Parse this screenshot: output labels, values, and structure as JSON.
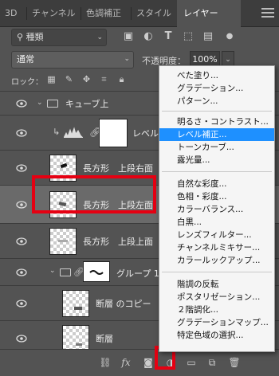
{
  "tabs": [
    "3D",
    "チャンネル",
    "色調補正",
    "スタイル",
    "レイヤー"
  ],
  "active_tab": "レイヤー",
  "toolbar": {
    "filter_label": "種類",
    "blend_mode": "通常",
    "opacity_label": "不透明度：",
    "opacity_value": "100%",
    "lock_label": "ロック："
  },
  "layers": [
    {
      "name": "キューブ上",
      "kind": "group"
    },
    {
      "name": "レベル補正",
      "kind": "adjustment"
    },
    {
      "name": "長方形　上段右面",
      "kind": "shape"
    },
    {
      "name": "長方形　上段左面",
      "kind": "shape",
      "selected": true
    },
    {
      "name": "長方形　上段上面",
      "kind": "shape"
    },
    {
      "name": "グループ 1",
      "kind": "group"
    },
    {
      "name": "断層 のコピー",
      "kind": "layer"
    },
    {
      "name": "断層",
      "kind": "layer"
    }
  ],
  "adjustment_menu": {
    "groups": [
      [
        "べた塗り...",
        "グラデーション...",
        "パターン..."
      ],
      [
        "明るさ・コントラスト...",
        "レベル補正...",
        "トーンカーブ...",
        "露光量..."
      ],
      [
        "自然な彩度...",
        "色相・彩度...",
        "カラーバランス...",
        "白黒...",
        "レンズフィルター...",
        "チャンネルミキサー...",
        "カラールックアップ..."
      ],
      [
        "階調の反転",
        "ポスタリゼーション...",
        "２階調化...",
        "グラデーションマップ...",
        "特定色域の選択..."
      ]
    ],
    "highlighted": "レベル補正..."
  },
  "bottom_bar": [
    "link-icon",
    "fx-icon",
    "mask-icon",
    "adjustment-icon",
    "folder-icon",
    "new-layer-icon",
    "trash-icon"
  ],
  "colors": {
    "highlight": "#1e90ff",
    "annotation": "#e60012"
  }
}
